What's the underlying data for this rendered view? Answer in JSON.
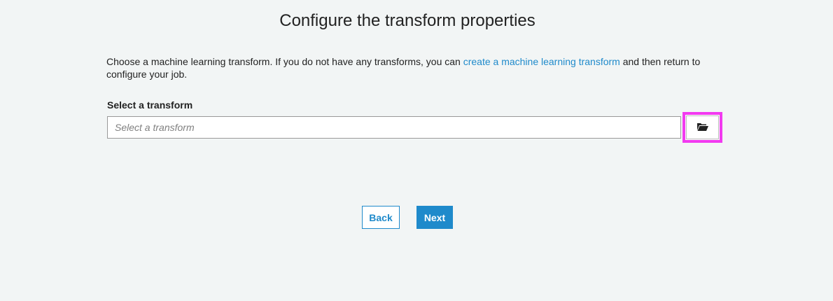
{
  "page": {
    "title": "Configure the transform properties"
  },
  "intro": {
    "text_before": "Choose a machine learning transform. If you do not have any transforms, you can ",
    "link_label": "create a machine learning transform",
    "text_after": " and then return to configure your job."
  },
  "transform_field": {
    "label": "Select a transform",
    "placeholder": "Select a transform",
    "value": "",
    "browse_icon": "folder-open-icon"
  },
  "actions": {
    "back_label": "Back",
    "next_label": "Next"
  },
  "colors": {
    "accent": "#1f8acb",
    "highlight": "#f23af0",
    "background": "#f2f5f5"
  }
}
